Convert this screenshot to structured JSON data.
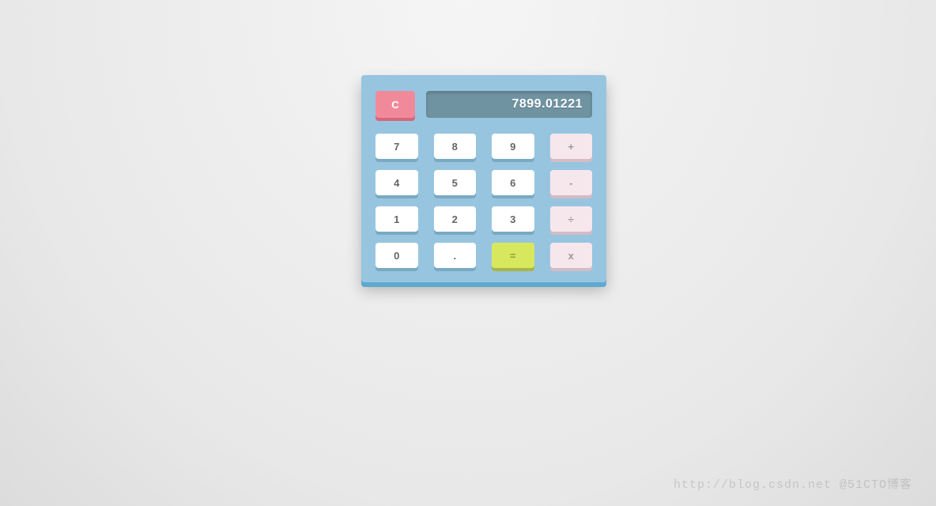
{
  "display": {
    "value": "7899.01221"
  },
  "buttons": {
    "clear": "C",
    "keypad": [
      {
        "label": "7",
        "type": "num"
      },
      {
        "label": "8",
        "type": "num"
      },
      {
        "label": "9",
        "type": "num"
      },
      {
        "label": "+",
        "type": "op"
      },
      {
        "label": "4",
        "type": "num"
      },
      {
        "label": "5",
        "type": "num"
      },
      {
        "label": "6",
        "type": "num"
      },
      {
        "label": "-",
        "type": "op"
      },
      {
        "label": "1",
        "type": "num"
      },
      {
        "label": "2",
        "type": "num"
      },
      {
        "label": "3",
        "type": "num"
      },
      {
        "label": "÷",
        "type": "op"
      },
      {
        "label": "0",
        "type": "num"
      },
      {
        "label": ".",
        "type": "num"
      },
      {
        "label": "=",
        "type": "eq"
      },
      {
        "label": "x",
        "type": "op"
      }
    ]
  },
  "watermark": "http://blog.csdn.net @51CTO博客"
}
